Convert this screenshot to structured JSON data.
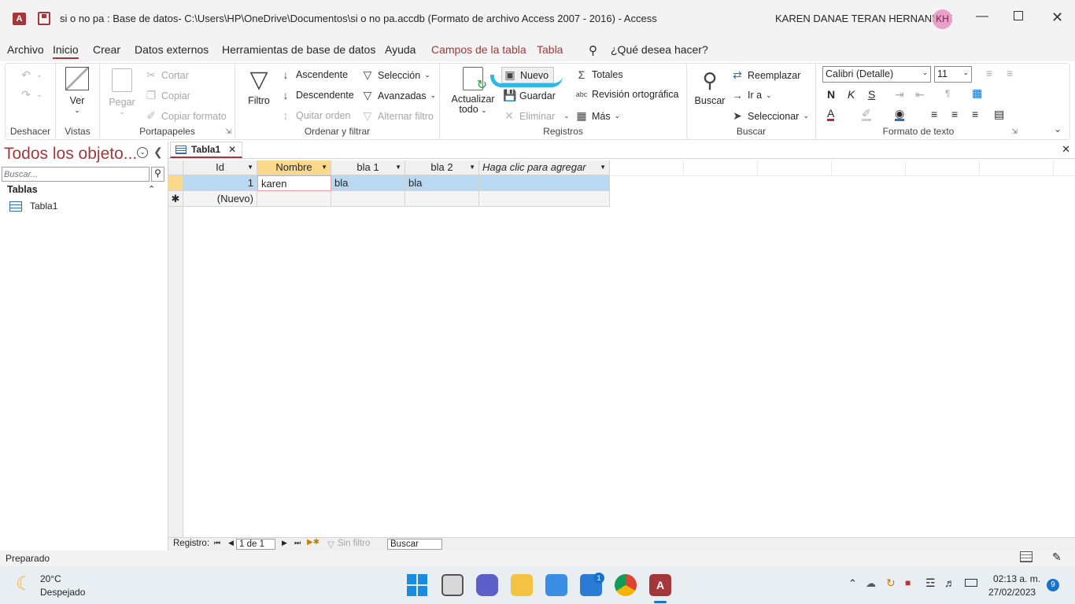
{
  "window": {
    "title": "si o no pa : Base de datos- C:\\Users\\HP\\OneDrive\\Documentos\\si o no pa.accdb (Formato de archivo Access 2007 - 2016)  -  Access",
    "user": "KAREN DANAE TERAN HERNANDEZ",
    "user_initials": "KH",
    "accent": "#a4373a"
  },
  "menu": {
    "items": [
      "Archivo",
      "Inicio",
      "Crear",
      "Datos externos",
      "Herramientas de base de datos",
      "Ayuda",
      "Campos de la tabla",
      "Tabla"
    ],
    "active": "Inicio",
    "search": "¿Qué desea hacer?"
  },
  "ribbon": {
    "deshacer": {
      "label": "Deshacer"
    },
    "vistas": {
      "label": "Vistas",
      "ver": "Ver"
    },
    "portapapeles": {
      "label": "Portapapeles",
      "pegar": "Pegar",
      "cortar": "Cortar",
      "copiar": "Copiar",
      "copiar_formato": "Copiar formato"
    },
    "ordenar": {
      "label": "Ordenar y filtrar",
      "filtro": "Filtro",
      "ascendente": "Ascendente",
      "descendente": "Descendente",
      "quitar_orden": "Quitar orden",
      "seleccion": "Selección",
      "avanzadas": "Avanzadas",
      "alternar_filtro": "Alternar filtro"
    },
    "registros": {
      "label": "Registros",
      "actualizar1": "Actualizar",
      "actualizar2": "todo",
      "nuevo": "Nuevo",
      "guardar": "Guardar",
      "eliminar": "Eliminar",
      "totales": "Totales",
      "revision": "Revisión ortográfica",
      "mas": "Más"
    },
    "buscar": {
      "label": "Buscar",
      "buscar": "Buscar",
      "reemplazar": "Reemplazar",
      "ir_a": "Ir a",
      "seleccionar": "Seleccionar"
    },
    "formato": {
      "label": "Formato de texto",
      "font": "Calibri (Detalle)",
      "size": "11",
      "bold": "N",
      "italic": "K",
      "underline": "S"
    }
  },
  "nav": {
    "title": "Todos los objeto...",
    "search_placeholder": "Buscar...",
    "section": "Tablas",
    "items": [
      "Tabla1"
    ]
  },
  "tab": {
    "name": "Tabla1"
  },
  "table": {
    "columns": [
      "Id",
      "Nombre",
      "bla 1",
      "bla 2",
      "Haga clic para agregar"
    ],
    "rows": [
      [
        "1",
        "karen",
        "bla",
        "bla",
        ""
      ]
    ],
    "new_row": "(Nuevo)"
  },
  "recordnav": {
    "label": "Registro:",
    "position": "1 de 1",
    "filter": "Sin filtro",
    "search": "Buscar"
  },
  "status": {
    "text": "Preparado"
  },
  "taskbar": {
    "temp": "20°C",
    "weather": "Despejado",
    "time": "02:13 a. m.",
    "date": "27/02/2023",
    "mail_badge": "1",
    "notif_badge": "9"
  }
}
